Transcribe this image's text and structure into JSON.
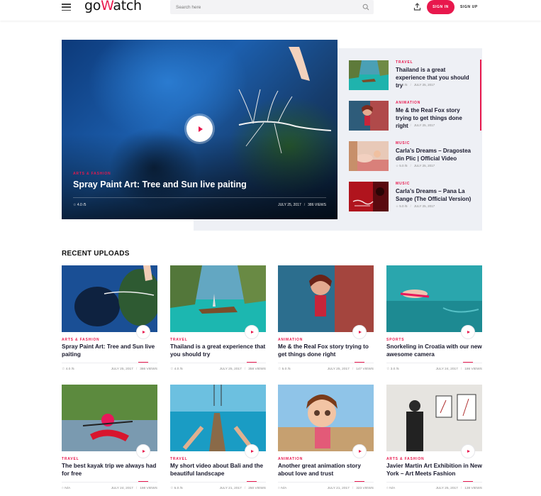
{
  "header": {
    "logo_prefix": "go",
    "logo_accent": "W",
    "logo_suffix": "atch",
    "search_placeholder": "Search here",
    "signin_label": "SIGN IN",
    "signup_label": "SIGN UP"
  },
  "colors": {
    "accent": "#e8184d",
    "title": "#1a1a2e",
    "panel": "#eef0f5"
  },
  "featured": {
    "category": "ARTS & FASHION",
    "title": "Spray Paint Art: Tree and Sun live paiting",
    "rating": "4.0 /5",
    "date": "JULY 25, 2017",
    "views": "386 VIEWS"
  },
  "side_list": [
    {
      "category": "TRAVEL",
      "title": "Thailand is a great experience that you should try",
      "rating": "4.0 /5",
      "date": "JULY 25, 2017"
    },
    {
      "category": "ANIMATION",
      "title": "Me & the Real Fox story trying to get things done right",
      "rating": "5.0 /5",
      "date": "JULY 25, 2017"
    },
    {
      "category": "MUSIC",
      "title": "Carla’s Dreams – Dragostea din Plic | Official Video",
      "rating": "5.0 /5",
      "date": "JULY 25, 2017"
    },
    {
      "category": "MUSIC",
      "title": "Carla’s Dreams – Pana La Sange (The Official Version)",
      "rating": "5.0 /5",
      "date": "JULY 25, 2017"
    }
  ],
  "recent": {
    "heading": "RECENT UPLOADS",
    "items": [
      {
        "category": "ARTS & FASHION",
        "title": "Spray Paint Art: Tree and Sun live paiting",
        "rating": "4.0 /5",
        "date": "JULY 25, 2017",
        "views": "386 VIEWS"
      },
      {
        "category": "TRAVEL",
        "title": "Thailand is a great experience that you should try",
        "rating": "4.0 /5",
        "date": "JULY 25, 2017",
        "views": "358 VIEWS"
      },
      {
        "category": "ANIMATION",
        "title": "Me & the Real Fox story trying to get things done right",
        "rating": "5.0 /5",
        "date": "JULY 25, 2017",
        "views": "147 VIEWS"
      },
      {
        "category": "SPORTS",
        "title": "Snorkeling in Croatia with our new awesome camera",
        "rating": "3.0 /5",
        "date": "JULY 24, 2017",
        "views": "186 VIEWS"
      },
      {
        "category": "TRAVEL",
        "title": "The best kayak trip we always had for free",
        "rating": "N/A",
        "date": "JULY 24, 2017",
        "views": "198 VIEWS"
      },
      {
        "category": "TRAVEL",
        "title": "My short video about Bali and the beautiful landscape",
        "rating": "5.0 /5",
        "date": "JULY 21, 2017",
        "views": "250 VIEWS"
      },
      {
        "category": "ANIMATION",
        "title": "Another great animation story about love and trust",
        "rating": "N/A",
        "date": "JULY 21, 2017",
        "views": "323 VIEWS"
      },
      {
        "category": "ARTS & FASHION",
        "title": "Javier Martin Art Exhibition in New York – Art Meets Fashion",
        "rating": "N/A",
        "date": "JULY 25, 2017",
        "views": "138 VIEWS"
      }
    ]
  }
}
